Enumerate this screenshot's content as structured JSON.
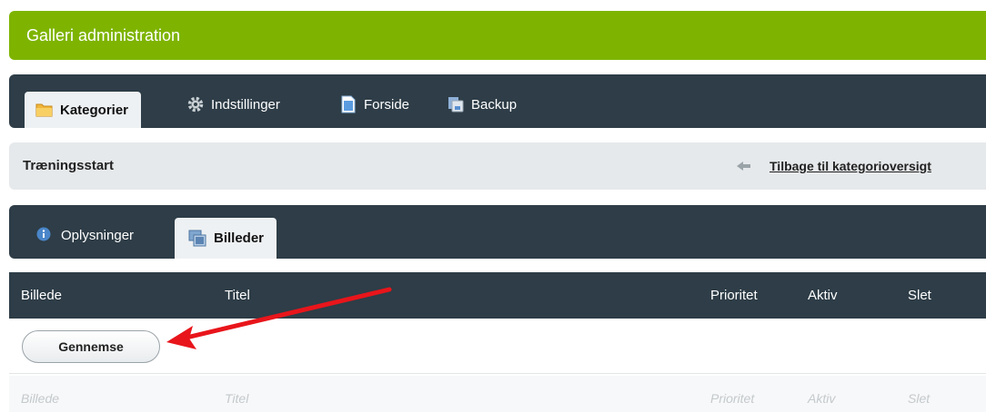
{
  "header": {
    "title": "Galleri administration"
  },
  "main_tabs": [
    {
      "label": "Kategorier",
      "icon": "folder-icon",
      "active": true
    },
    {
      "label": "Indstillinger",
      "icon": "gear-icon",
      "active": false
    },
    {
      "label": "Forside",
      "icon": "page-icon",
      "active": false
    },
    {
      "label": "Backup",
      "icon": "backup-icon",
      "active": false
    }
  ],
  "page": {
    "title": "Træningsstart",
    "back_link": "Tilbage til kategorioversigt"
  },
  "sub_tabs": [
    {
      "label": "Oplysninger",
      "icon": "info-icon",
      "active": false
    },
    {
      "label": "Billeder",
      "icon": "images-icon",
      "active": true
    }
  ],
  "table": {
    "columns": [
      "Billede",
      "Titel",
      "Prioritet",
      "Aktiv",
      "Slet"
    ],
    "browse_label": "Gennemse",
    "footer_columns": [
      "Billede",
      "Titel",
      "Prioritet",
      "Aktiv",
      "Slet"
    ]
  },
  "colors": {
    "header_green": "#7eb400",
    "dark_bar": "#2e3d47",
    "annotation_red": "#e8151b"
  }
}
